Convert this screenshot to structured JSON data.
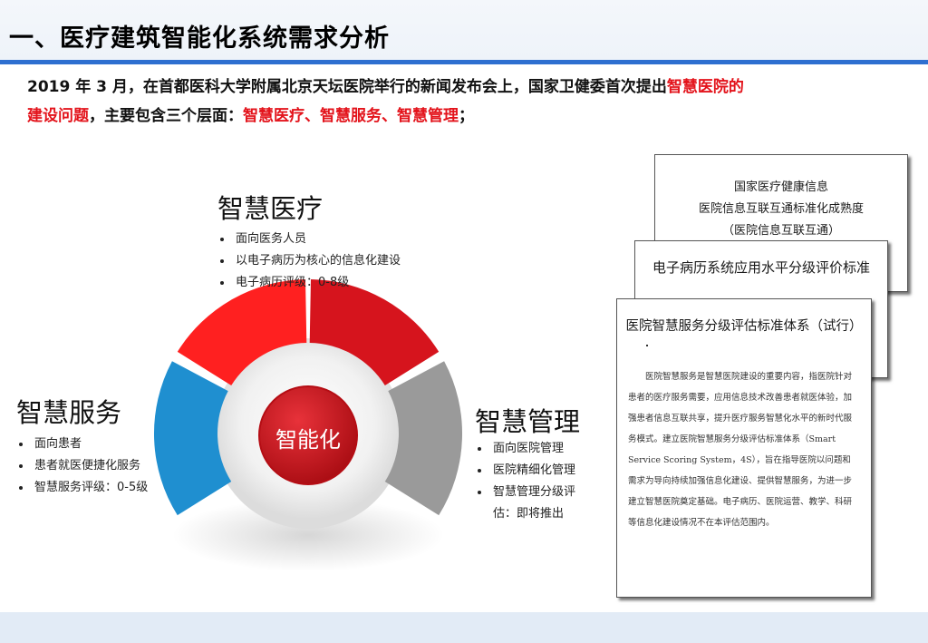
{
  "header": {
    "title": "一、医疗建筑智能化系统需求分析"
  },
  "intro": {
    "part1": "2019 年 3 月，在首都医科大学附属北京天坛医院举行的新闻发布会上，国家卫健委首次提出",
    "highlight1": "智慧医院的建设问题",
    "part2": "，主要包含三个层面：",
    "highlight2": "智慧医疗、智慧服务、智慧管理",
    "part3": "；"
  },
  "diagram": {
    "center_label": "智能化",
    "medical": {
      "title": "智慧医疗",
      "items": [
        "面向医务人员",
        "以电子病历为核心的信息化建设",
        "电子病历评级：0-8级"
      ]
    },
    "service": {
      "title": "智慧服务",
      "items": [
        "面向患者",
        "患者就医便捷化服务",
        "智慧服务评级：0-5级"
      ]
    },
    "management": {
      "title": "智慧管理",
      "items": [
        "面向医院管理",
        "医院精细化管理",
        "智慧管理分级评估：即将推出"
      ]
    },
    "colors": {
      "red_light": "#ff2020",
      "red_dark": "#d6141d",
      "blue": "#1f8fd0",
      "gray": "#9a9a9a",
      "center": "#cc1018"
    }
  },
  "documents": {
    "doc1": {
      "line1": "国家医疗健康信息",
      "line2": "医院信息互联互通标准化成熟度",
      "line3": "（医院信息互联互通）"
    },
    "doc2": {
      "title": "电子病历系统应用水平分级评价标准"
    },
    "doc3": {
      "title": "医院智慧服务分级评估标准体系（试行）",
      "body": "医院智慧服务是智慧医院建设的重要内容，指医院针对患者的医疗服务需要，应用信息技术改善患者就医体验，加强患者信息互联共享，提升医疗服务智慧化水平的新时代服务模式。建立医院智慧服务分级评估标准体系（Smart Service Scoring System，4S），旨在指导医院以问题和需求为导向持续加强信息化建设、提供智慧服务，为进一步建立智慧医院奠定基础。电子病历、医院运营、教学、科研等信息化建设情况不在本评估范围内。"
    }
  }
}
